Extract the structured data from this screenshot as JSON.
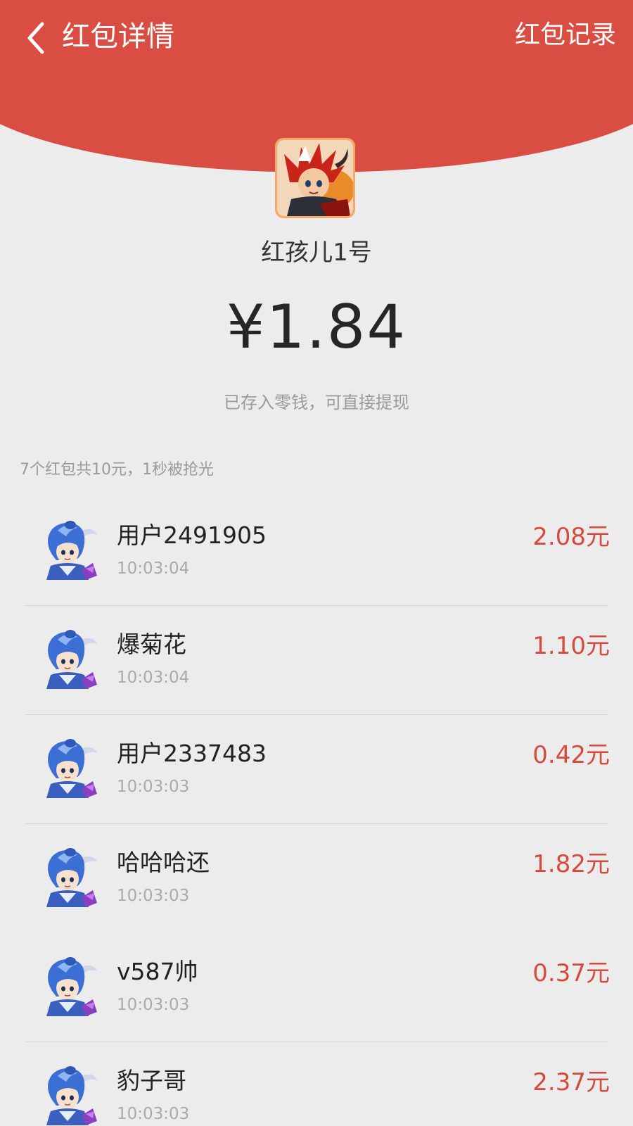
{
  "header": {
    "back_icon": "chevron-left-icon",
    "title": "红包详情",
    "record_link": "红包记录",
    "bg_color": "#d94d42"
  },
  "sender": {
    "name": "红孩儿1号",
    "amount": "¥1.84",
    "note": "已存入零钱，可直接提现"
  },
  "summary": "7个红包共10元，1秒被抢光",
  "colors": {
    "accent": "#d64a3e",
    "background": "#ececec"
  },
  "records": [
    {
      "name": "用户2491905",
      "time": "10:03:04",
      "amount": "2.08元"
    },
    {
      "name": "爆菊花",
      "time": "10:03:04",
      "amount": "1.10元"
    },
    {
      "name": "用户2337483",
      "time": "10:03:03",
      "amount": "0.42元"
    },
    {
      "name": "哈哈哈还",
      "time": "10:03:03",
      "amount": "1.82元"
    },
    {
      "name": "v587帅",
      "time": "10:03:03",
      "amount": "0.37元"
    },
    {
      "name": "豹子哥",
      "time": "10:03:03",
      "amount": "2.37元"
    }
  ]
}
